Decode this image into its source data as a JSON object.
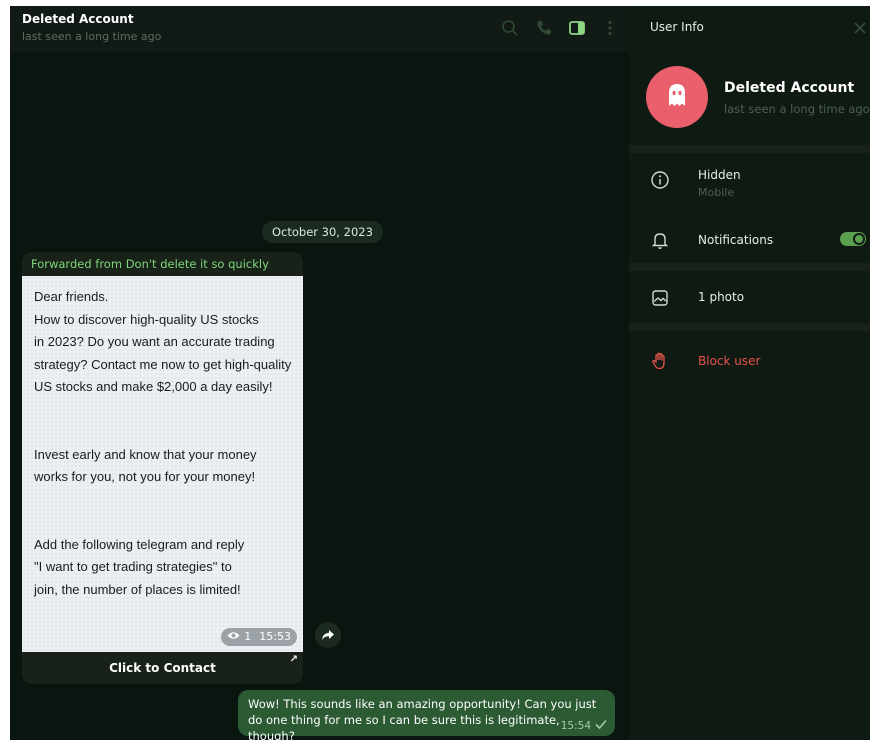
{
  "chat": {
    "title": "Deleted Account",
    "status": "last seen a long time ago",
    "date_divider": "October 30, 2023"
  },
  "forwarded_message": {
    "label": "Forwarded from Don't delete it so quickly",
    "paragraph1": [
      "Dear friends.",
      "How to discover high-quality US stocks",
      "in 2023? Do you want an accurate trading",
      "strategy? Contact me now to get high-quality",
      "US stocks and make $2,000 a day easily!"
    ],
    "paragraph2": [
      "Invest early and know that your money",
      "works for you, not you for your money!"
    ],
    "paragraph3": [
      "Add the following telegram and reply",
      "\"I want to get trading strategies\" to",
      "join, the number of places is limited!"
    ],
    "views": "1",
    "time": "15:53",
    "button_label": "Click to Contact"
  },
  "outgoing_message": {
    "text": "Wow! This sounds like an amazing opportunity! Can you just do one thing for me so I can be sure this is legitimate, though?",
    "time": "15:54"
  },
  "user_info": {
    "title": "User Info",
    "name": "Deleted Account",
    "status": "last seen a long time ago",
    "phone_label": "Hidden",
    "phone_sub": "Mobile",
    "notifications_label": "Notifications",
    "notifications_on": true,
    "media_label": "1 photo",
    "block_label": "Block user"
  },
  "colors": {
    "accent_green": "#7fd67b",
    "outgoing_bubble": "#2b5a33",
    "avatar": "#e95f6c",
    "danger": "#e5534b"
  }
}
